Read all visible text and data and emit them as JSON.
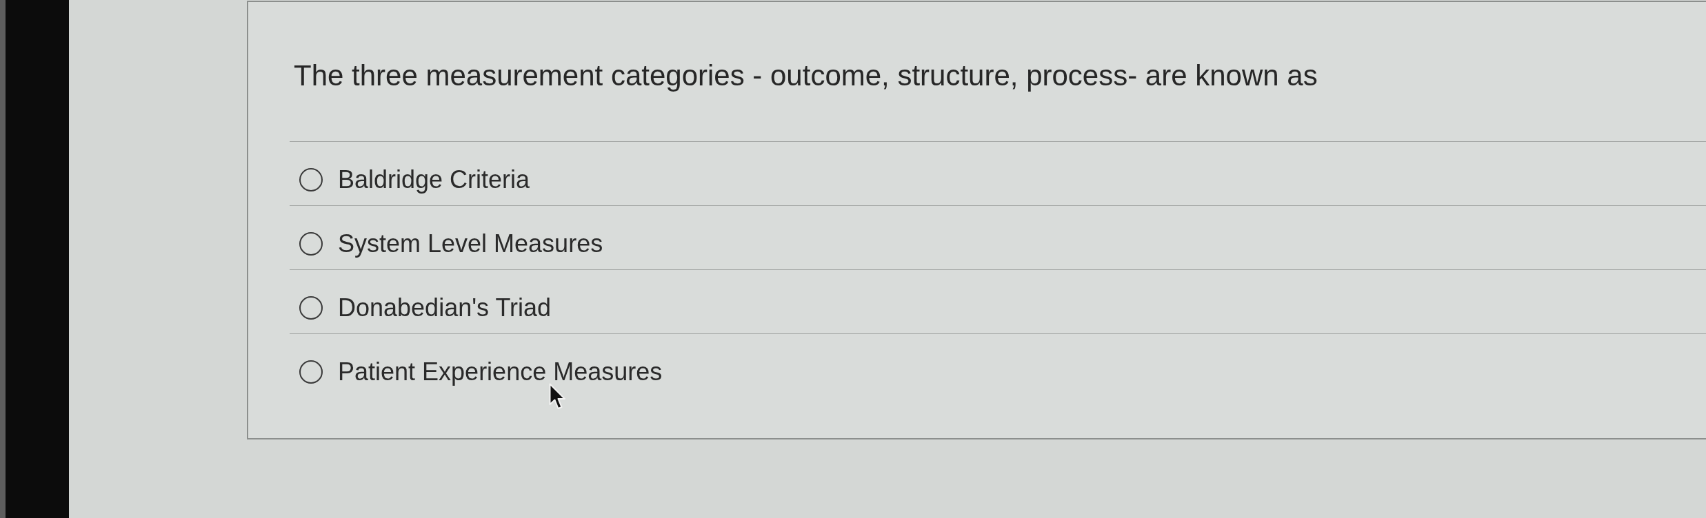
{
  "question": {
    "text": "The three measurement categories - outcome, structure, process- are known as"
  },
  "options": [
    {
      "label": "Baldridge Criteria",
      "selected": false
    },
    {
      "label": "System Level Measures",
      "selected": false
    },
    {
      "label": "Donabedian's Triad",
      "selected": false
    },
    {
      "label": "Patient Experience Measures",
      "selected": false
    }
  ]
}
